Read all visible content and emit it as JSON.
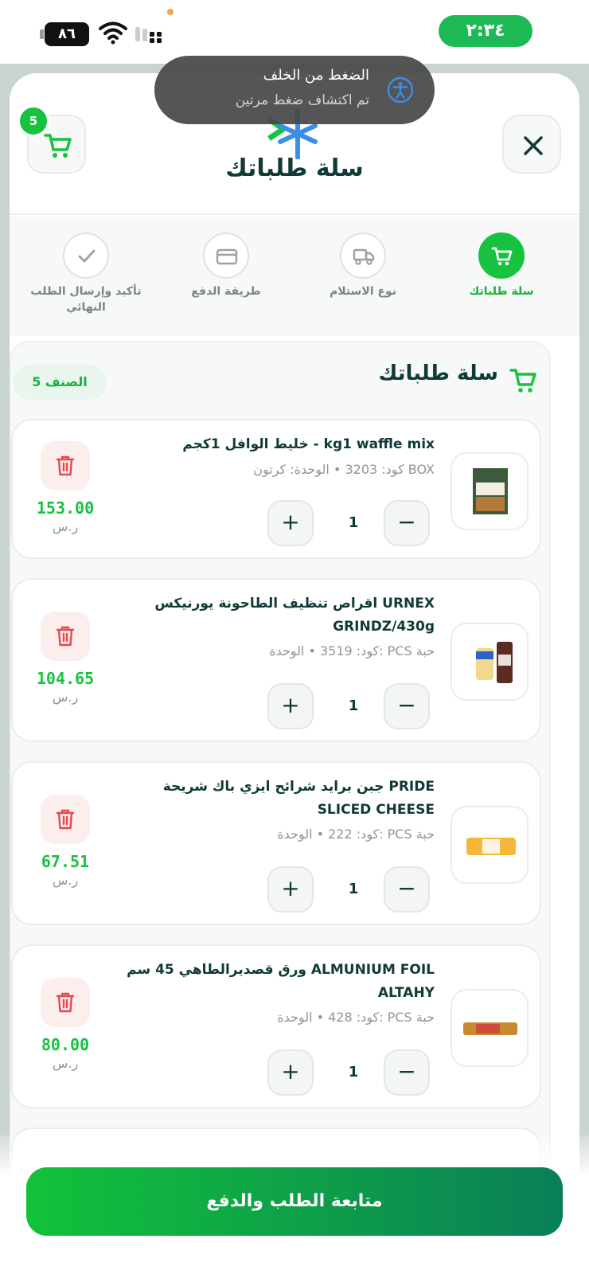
{
  "status_bar": {
    "battery": "٨٦",
    "time": "٢:٣٤"
  },
  "header": {
    "title": "سلة طلباتك",
    "cart_badge": "5"
  },
  "toast": {
    "title": "الضغط من الخلف",
    "subtitle": "تم اكتشاف ضغط مرتين"
  },
  "steps": [
    {
      "label": "سلة طلباتك",
      "icon": "cart-icon",
      "active": true
    },
    {
      "label": "نوع الاستلام",
      "icon": "truck-icon",
      "active": false
    },
    {
      "label": "طريقة الدفع",
      "icon": "card-icon",
      "active": false
    },
    {
      "label": "تأكيد وإرسال الطلب النهائي",
      "icon": "check-icon",
      "active": false
    }
  ],
  "cart": {
    "title": "سلة طلباتك",
    "count_label": "5 الصنف",
    "items": [
      {
        "name": "خليط الوافل 1كجم - kg1 waffle mix",
        "meta": "كود: 3203 • الوحدة: كرتون BOX",
        "qty": "1",
        "price": "153.00",
        "currency": "ر.س"
      },
      {
        "name": "اقراص تنظيف الطاحونة يورنيكس URNEX GRINDZ/430g",
        "meta": "كود: 3519 • الوحدة: PCS حبة",
        "qty": "1",
        "price": "104.65",
        "currency": "ر.س"
      },
      {
        "name": "جبن برايد شرائح ايزي باك شريحة PRIDE SLICED CHEESE",
        "meta": "كود: 222 • الوحدة: PCS حبة",
        "qty": "1",
        "price": "67.51",
        "currency": "ر.س"
      },
      {
        "name": "ورق قصديرالطاهي 45 سم ALMUNIUM FOIL ALTAHY",
        "meta": "كود: 428 • الوحدة: PCS حبة",
        "qty": "1",
        "price": "80.00",
        "currency": "ر.س"
      }
    ]
  },
  "footer": {
    "checkout_label": "متابعة الطلب والدفع"
  },
  "colors": {
    "brand_green": "#17c23f",
    "brand_dark": "#103a36",
    "delete_red": "#e5484d"
  }
}
